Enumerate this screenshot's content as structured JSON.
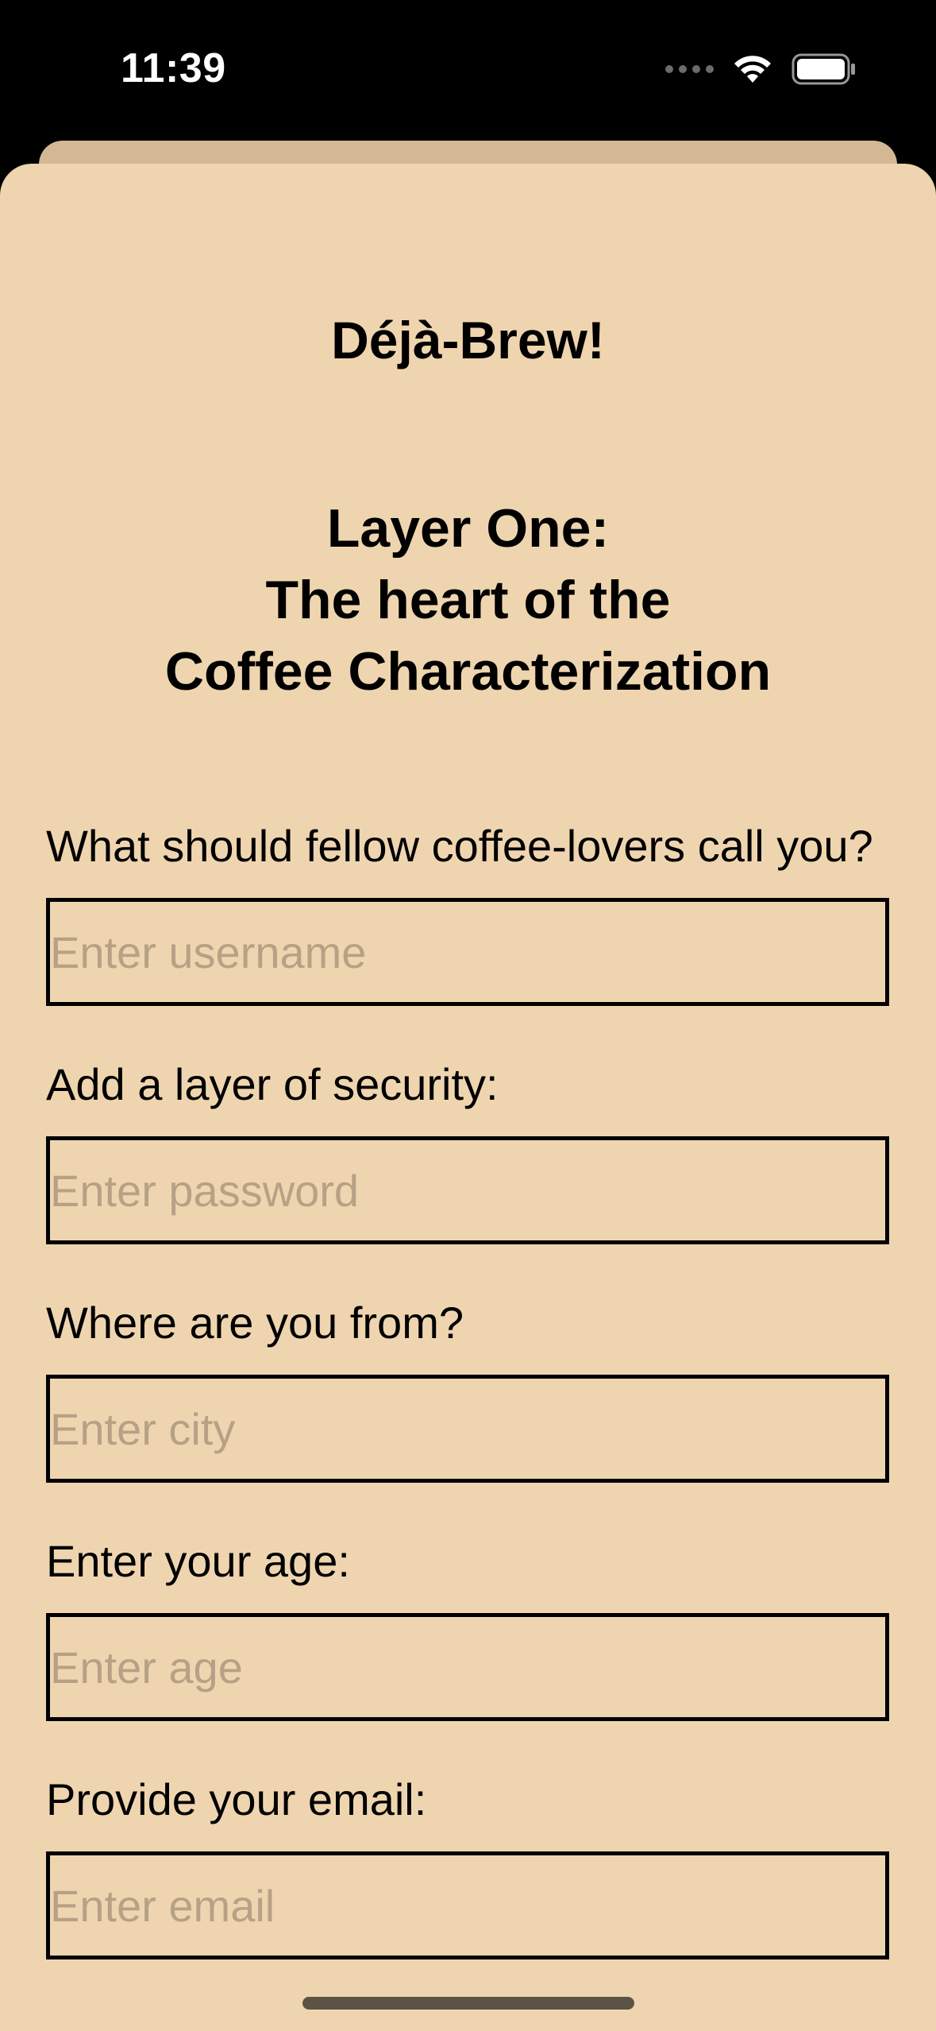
{
  "status_bar": {
    "time": "11:39"
  },
  "app": {
    "title": "Déjà-Brew!",
    "heading_lines": [
      "Layer One:",
      "The heart of the",
      "Coffee Characterization"
    ]
  },
  "form": {
    "fields": [
      {
        "label": "What should fellow coffee-lovers call you?",
        "placeholder": "Enter username",
        "value": ""
      },
      {
        "label": "Add a layer of security:",
        "placeholder": "Enter password",
        "value": ""
      },
      {
        "label": "Where are you from?",
        "placeholder": "Enter city",
        "value": ""
      },
      {
        "label": "Enter your age:",
        "placeholder": "Enter age",
        "value": ""
      },
      {
        "label": "Provide your email:",
        "placeholder": "Enter email",
        "value": ""
      }
    ]
  },
  "colors": {
    "background": "#efd5af",
    "sheet_behind": "#d3b894",
    "placeholder": "#b7a186",
    "border": "#000000"
  },
  "icons": [
    "cellular-signal-icon",
    "wifi-icon",
    "battery-icon"
  ]
}
